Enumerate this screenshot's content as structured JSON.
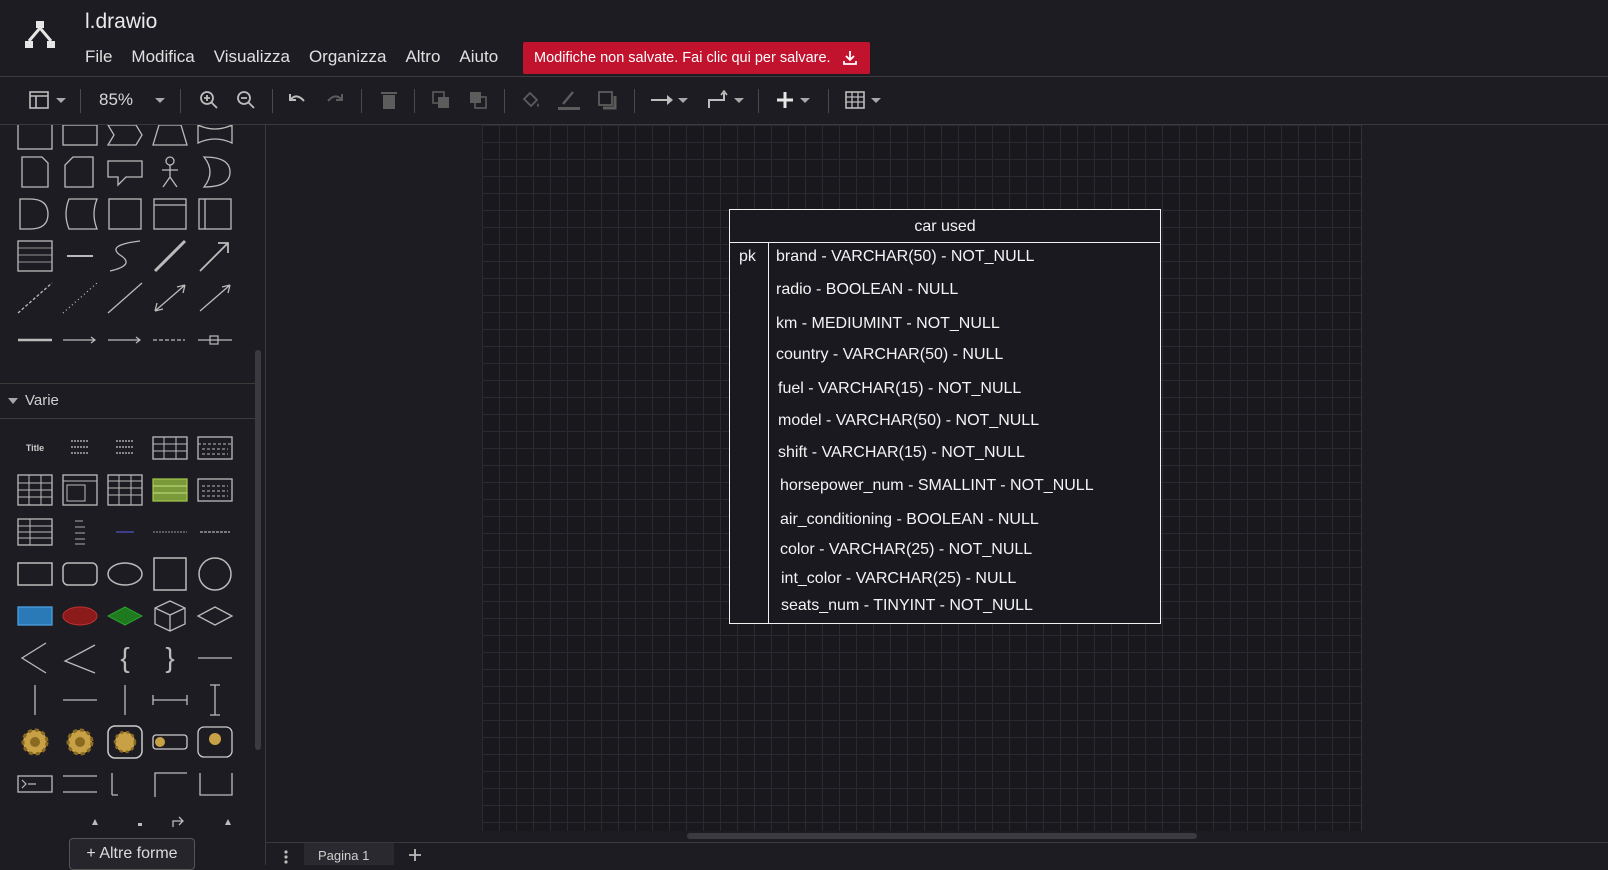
{
  "app": {
    "document_title": "l.drawio",
    "menu": [
      "File",
      "Modifica",
      "Visualizza",
      "Organizza",
      "Altro",
      "Aiuto"
    ],
    "save_banner": "Modifiche non salvate. Fai clic qui per salvare.",
    "accent_color": "#c1122e"
  },
  "toolbar": {
    "zoom": "85%",
    "icons": [
      "panel-layout-icon",
      "zoom-in-icon",
      "zoom-out-icon",
      "undo-icon",
      "redo-icon",
      "delete-icon",
      "to-front-icon",
      "to-back-icon",
      "fill-color-icon",
      "line-color-icon",
      "shadow-icon",
      "connection-icon",
      "waypoints-icon",
      "insert-plus-icon",
      "table-icon"
    ]
  },
  "sidebar": {
    "section_label": "Varie",
    "more_shapes_label": "+ Altre forme",
    "shape_title_label": "Title"
  },
  "diagram": {
    "table_name": "car used",
    "pk_label": "pk",
    "fields": [
      "brand - VARCHAR(50) - NOT_NULL",
      "radio - BOOLEAN - NULL",
      "km - MEDIUMINT - NOT_NULL",
      "country - VARCHAR(50) - NULL",
      "fuel - VARCHAR(15) - NOT_NULL",
      "model - VARCHAR(50) - NOT_NULL",
      "shift - VARCHAR(15) - NOT_NULL",
      "horsepower_num - SMALLINT - NOT_NULL",
      "air_conditioning - BOOLEAN - NULL",
      "color - VARCHAR(25) - NOT_NULL",
      "int_color - VARCHAR(25) - NULL",
      "seats_num - TINYINT - NOT_NULL"
    ]
  },
  "bottom": {
    "page_tab": "Pagina 1"
  }
}
